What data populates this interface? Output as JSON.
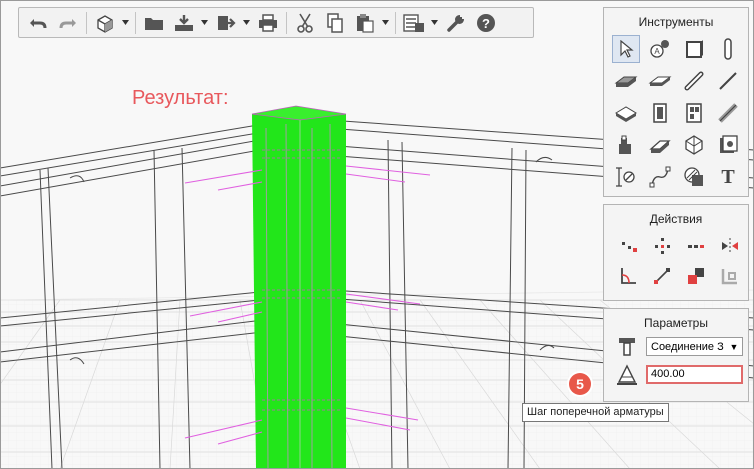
{
  "scene_label": "Результат:",
  "toolbar": {
    "buttons": [
      {
        "name": "undo-button",
        "icon": "undo-icon"
      },
      {
        "name": "redo-button",
        "icon": "redo-icon"
      },
      {
        "name": "view-cube-button",
        "icon": "cube-icon"
      },
      {
        "name": "open-button",
        "icon": "folder-icon"
      },
      {
        "name": "import-button",
        "icon": "import-icon"
      },
      {
        "name": "export-button",
        "icon": "export-icon"
      },
      {
        "name": "print-button",
        "icon": "printer-icon"
      },
      {
        "name": "cut-button",
        "icon": "scissors-icon"
      },
      {
        "name": "copy-button",
        "icon": "copy-icon"
      },
      {
        "name": "paste-button",
        "icon": "paste-icon"
      },
      {
        "name": "properties-button",
        "icon": "properties-icon"
      },
      {
        "name": "settings-button",
        "icon": "wrench-icon"
      },
      {
        "name": "help-button",
        "icon": "help-icon"
      }
    ]
  },
  "tools_panel": {
    "title": "Инструменты",
    "items": [
      "select-arrow-icon",
      "node-tool-icon",
      "panel-tool-icon",
      "column-tool-icon",
      "slab-tool-icon",
      "plate-tool-icon",
      "bar-tool-icon",
      "line-tool-icon",
      "cut-tool-icon",
      "wall-tool-icon",
      "door-tool-icon",
      "divide-tool-icon",
      "stair-tool-icon",
      "pipe-tool-icon",
      "polyhedron-tool-icon",
      "image-tool-icon",
      "dimension-tool-icon",
      "curve-tool-icon",
      "hatch-tool-icon",
      "text-tool-icon"
    ],
    "text_tool_glyph": "T"
  },
  "actions_panel": {
    "title": "Действия",
    "items": [
      "move-points-icon",
      "rotate-points-icon",
      "array-icon",
      "mirror-icon",
      "angle-icon",
      "connect-icon",
      "align-icon",
      "copy-shape-icon"
    ]
  },
  "params_panel": {
    "title": "Параметры",
    "connection_select": {
      "value": "Соединение З",
      "icon": "connection-type-icon"
    },
    "step_input": {
      "value": "400.00",
      "icon": "rebar-step-icon"
    }
  },
  "step_badge": "5",
  "tooltip": "Шаг поперечной арматуры",
  "colors": {
    "accent": "#e8584a",
    "column": "#22e61a",
    "rebar": "#e060e0",
    "label": "#e8585c"
  }
}
